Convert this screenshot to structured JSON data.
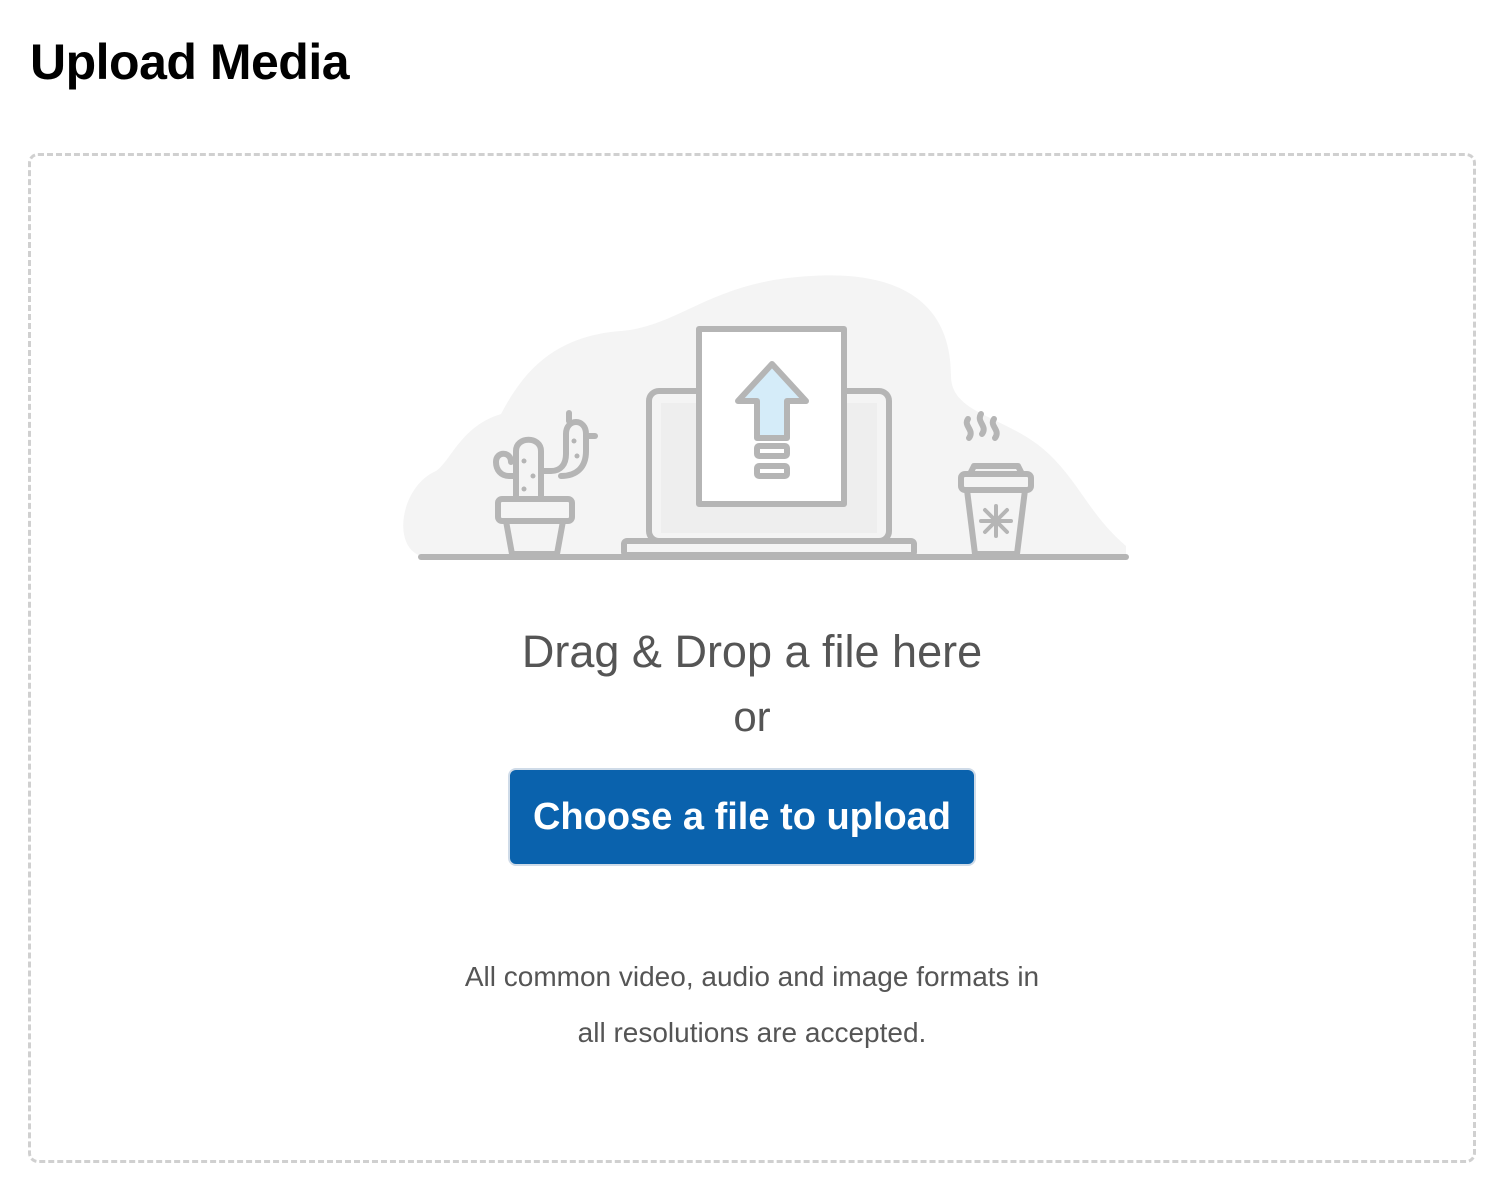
{
  "header": {
    "title": "Upload Media"
  },
  "dropzone": {
    "drag_text": "Drag & Drop a file here",
    "or_text": "or",
    "button_label": "Choose a file to upload",
    "formats_line1": "All common video, audio and image formats in",
    "formats_line2": "all resolutions are accepted.",
    "illustration_icon": "upload-illustration-icon"
  },
  "colors": {
    "button_bg": "#0a62ad",
    "button_text": "#ffffff",
    "text_gray": "#555555",
    "border_dashed": "#d0d0d0",
    "arrow_fill": "#d5ecf9",
    "line_art": "#b5b5b5",
    "blob_bg": "#f4f4f4"
  }
}
